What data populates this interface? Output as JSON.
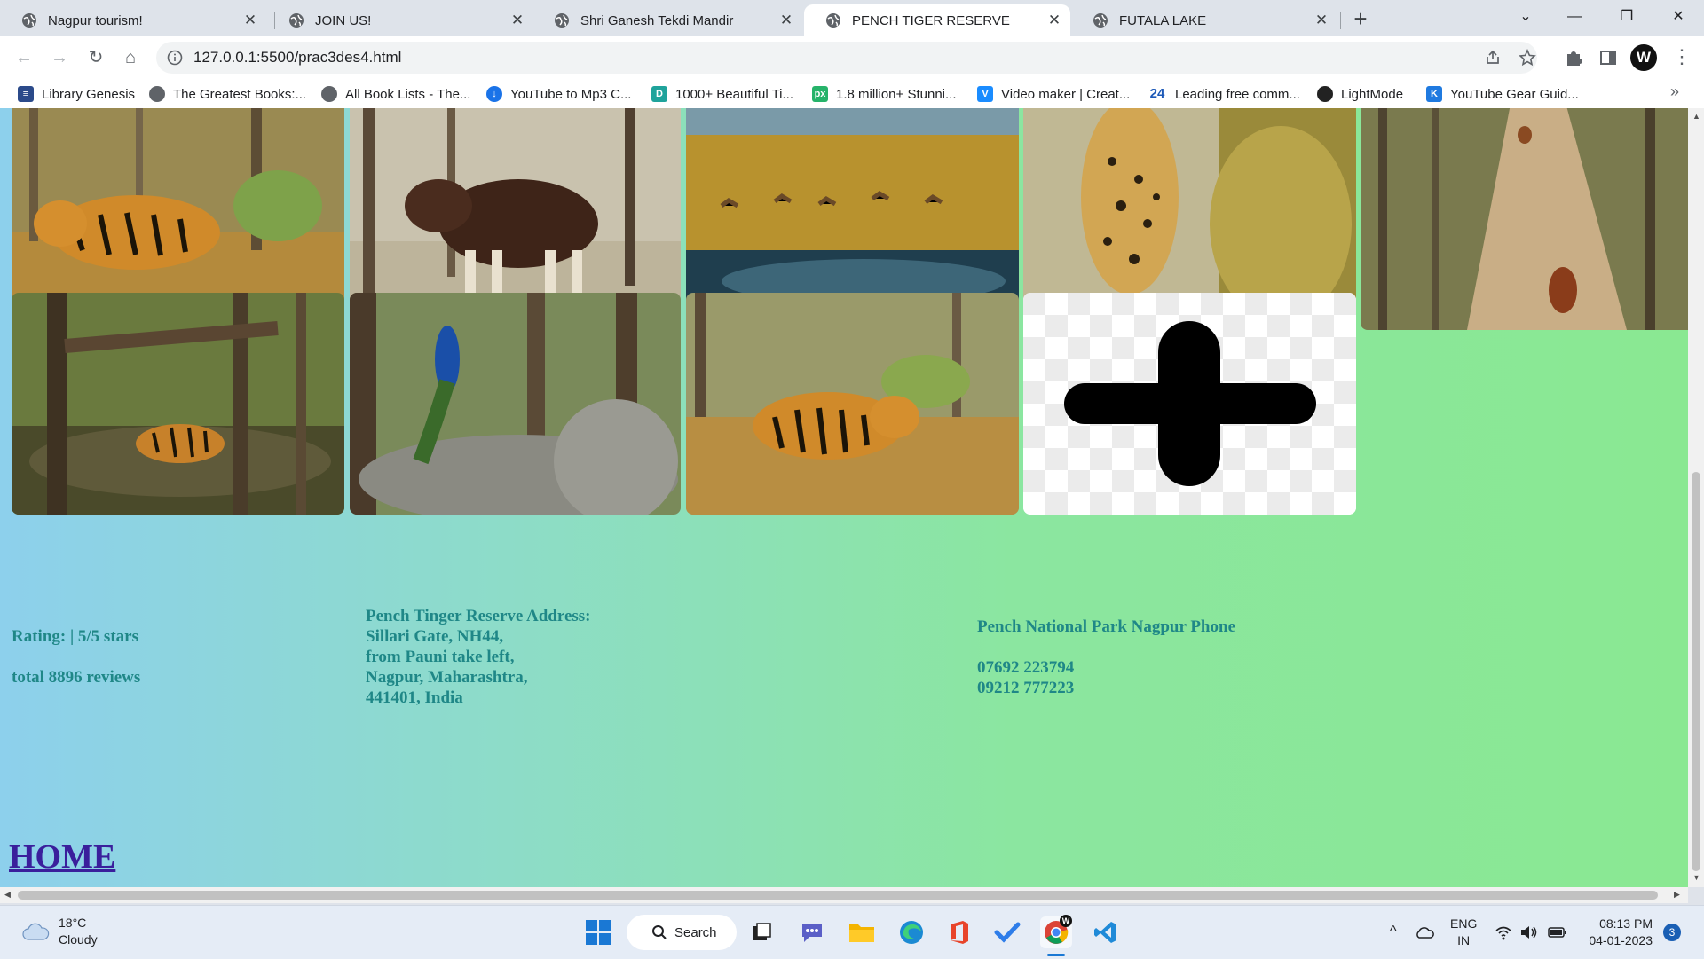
{
  "browser": {
    "tabs": [
      {
        "title": "Nagpur tourism!",
        "active": false
      },
      {
        "title": "JOIN US!",
        "active": false
      },
      {
        "title": "Shri Ganesh Tekdi Mandir",
        "active": false
      },
      {
        "title": "PENCH TIGER RESERVE",
        "active": true
      },
      {
        "title": "FUTALA LAKE",
        "active": false
      }
    ],
    "url": "127.0.0.1:5500/prac3des4.html",
    "profile_initial": "W",
    "bookmarks": [
      {
        "label": "Library Genesis",
        "icon": "library-genesis-icon",
        "color": "#2b4a8a"
      },
      {
        "label": "The Greatest Books:...",
        "icon": "globe-icon",
        "color": "#5f6368"
      },
      {
        "label": "All Book Lists - The...",
        "icon": "globe-icon",
        "color": "#5f6368"
      },
      {
        "label": "YouTube to Mp3 C...",
        "icon": "cloud-download-icon",
        "color": "#1a73e8"
      },
      {
        "label": "1000+ Beautiful Ti...",
        "icon": "d-icon",
        "color": "#1fa39b"
      },
      {
        "label": "1.8 million+ Stunni...",
        "icon": "px-icon",
        "color": "#26b36a"
      },
      {
        "label": "Video maker | Creat...",
        "icon": "v-icon",
        "color": "#1a8cff"
      },
      {
        "label": "Leading free comm...",
        "icon": "24-icon",
        "color": "#1e5ab8"
      },
      {
        "label": "LightMode",
        "icon": "lightmode-icon",
        "color": "#222222"
      },
      {
        "label": "YouTube Gear Guid...",
        "icon": "k-icon",
        "color": "#1f7ae0"
      }
    ]
  },
  "page": {
    "gallery": [
      {
        "name": "tiger-image"
      },
      {
        "name": "gaur-image"
      },
      {
        "name": "deer-lake-image"
      },
      {
        "name": "leopard-image"
      },
      {
        "name": "wild-dog-image"
      },
      {
        "name": "tiger-water-image"
      },
      {
        "name": "peacock-image"
      },
      {
        "name": "tiger-walking-image"
      },
      {
        "name": "add-image-placeholder"
      }
    ],
    "rating": {
      "line1": "Rating: | 5/5 stars",
      "line2": "total 8896 reviews"
    },
    "address": {
      "heading": "Pench Tinger Reserve Address:",
      "lines": [
        "Sillari Gate, NH44,",
        "from Pauni take left,",
        "Nagpur, Maharashtra,",
        "441401, India"
      ]
    },
    "phone": {
      "heading": "Pench National Park Nagpur Phone",
      "numbers": [
        "07692 223794",
        "09212 777223"
      ]
    },
    "home_link": "HOME"
  },
  "taskbar": {
    "weather_temp": "18°C",
    "weather_desc": "Cloudy",
    "search_label": "Search",
    "language": "ENG",
    "region": "IN",
    "time": "08:13 PM",
    "date": "04-01-2023",
    "notification_count": "3"
  }
}
